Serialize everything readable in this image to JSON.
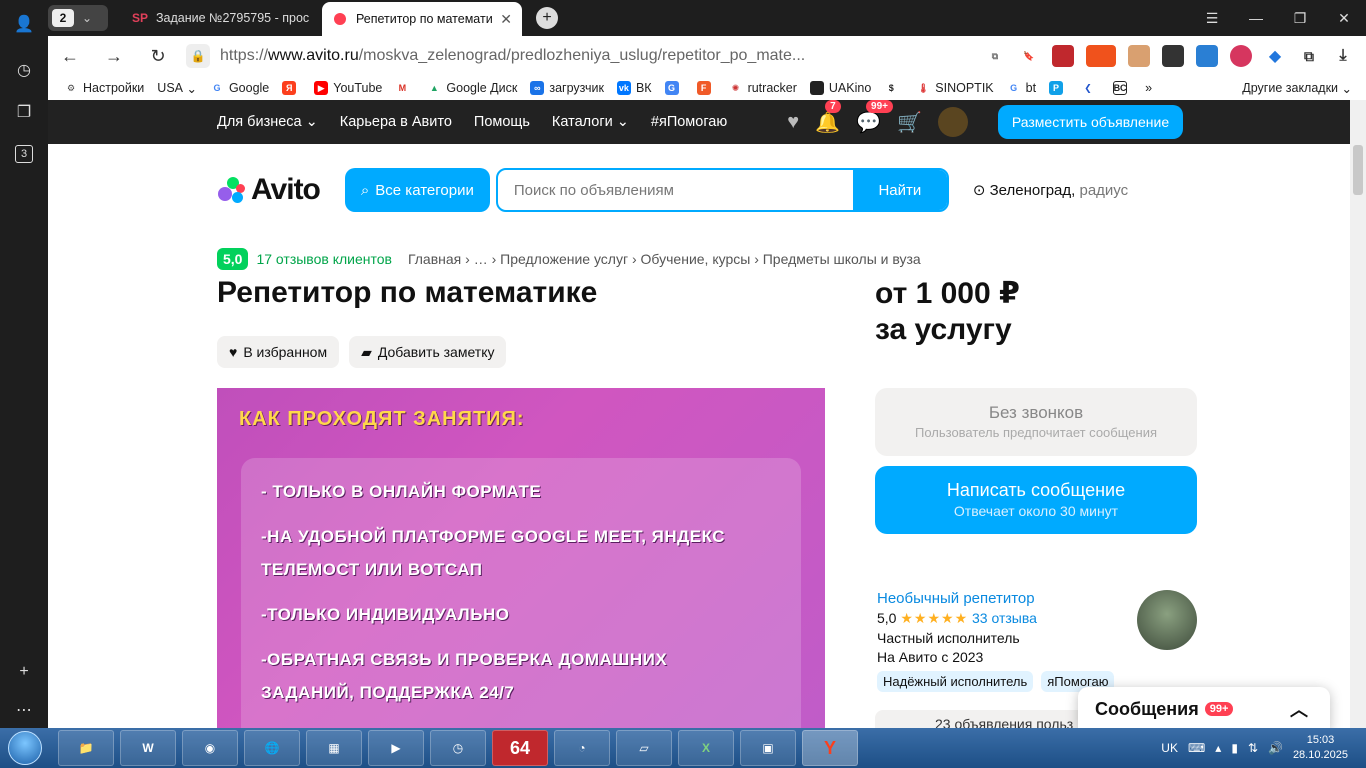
{
  "browser": {
    "tab_count": "2",
    "tabs": [
      {
        "favicon": "SP",
        "title": "Задание №2795795 - прос",
        "color": "#e1405a"
      },
      {
        "favicon": "•",
        "title": "Репетитор по математи",
        "color": "#ff4053"
      }
    ],
    "url_prefix": "https://",
    "url_domain": "www.avito.ru",
    "url_path": "/moskva_zelenograd/predlozheniya_uslug/repetitor_po_mate...",
    "bookmarks": [
      "Настройки",
      "USA",
      "Google",
      "",
      "YouTube",
      "",
      "Google Диск",
      "загрузчик",
      "ВК",
      "",
      "",
      "rutracker",
      "UAKino",
      "",
      "SINOPTIK",
      "bt",
      "",
      "",
      ""
    ],
    "bookmarks_overflow": "»",
    "other_bookmarks": "Другие закладки",
    "rail_badge": "3"
  },
  "avito": {
    "nav_links": [
      "Для бизнеса ⌄",
      "Карьера в Авито",
      "Помощь",
      "Каталоги ⌄",
      "#яПомогаю"
    ],
    "notif_count": "7",
    "msg_count": "99+",
    "post_button": "Разместить объявление",
    "logo": "Avito",
    "categories_button": "Все категории",
    "search_placeholder": "Поиск по объявлениям",
    "search_button": "Найти",
    "location": "Зеленоград,",
    "location_radius": "радиус",
    "rating": "5,0",
    "reviews_link": "17 отзывов клиентов",
    "breadcrumbs": "Главная › … › Предложение услуг › Обучение, курсы › Предметы школы и вуза",
    "title": "Репетитор по математике",
    "fav_button": "В избранном",
    "note_button": "Добавить заметку",
    "photo_heading": "КАК ПРОХОДЯТ ЗАНЯТИЯ:",
    "photo_lines": [
      "- ТОЛЬКО В ОНЛАЙН ФОРМАТЕ",
      "-НА УДОБНОЙ ПЛАТФОРМЕ GOOGLE MEET, ЯНДЕКС",
      "ТЕЛЕМОСТ ИЛИ ВОТСАП",
      "-ТОЛЬКО ИНДИВИДУАЛЬНО",
      "-ОБРАТНАЯ СВЯЗЬ И ПРОВЕРКА ДОМАШНИХ",
      "ЗАДАНИЙ, ПОДДЕРЖКА 24/7"
    ],
    "price_line1": "от 1 000 ₽",
    "price_line2": "за услугу",
    "no_calls": "Без звонков",
    "no_calls_sub": "Пользователь предпочитает сообщения",
    "write_message": "Написать сообщение",
    "write_message_sub": "Отвечает около 30 минут",
    "seller_name": "Необычный репетитор",
    "seller_rating": "5,0",
    "seller_stars": "★★★★★",
    "seller_reviews": "33 отзыва",
    "seller_type": "Частный исполнитель",
    "seller_since": "На Авито с 2023",
    "tags": [
      "Надёжный исполнитель",
      "яПомогаю"
    ],
    "more_ads": "23 объявления польз",
    "messages_popup": "Сообщения",
    "messages_count": "99+"
  },
  "taskbar": {
    "lang": "UK",
    "time": "15:03",
    "date": "28.10.2025",
    "app_64": "64"
  }
}
